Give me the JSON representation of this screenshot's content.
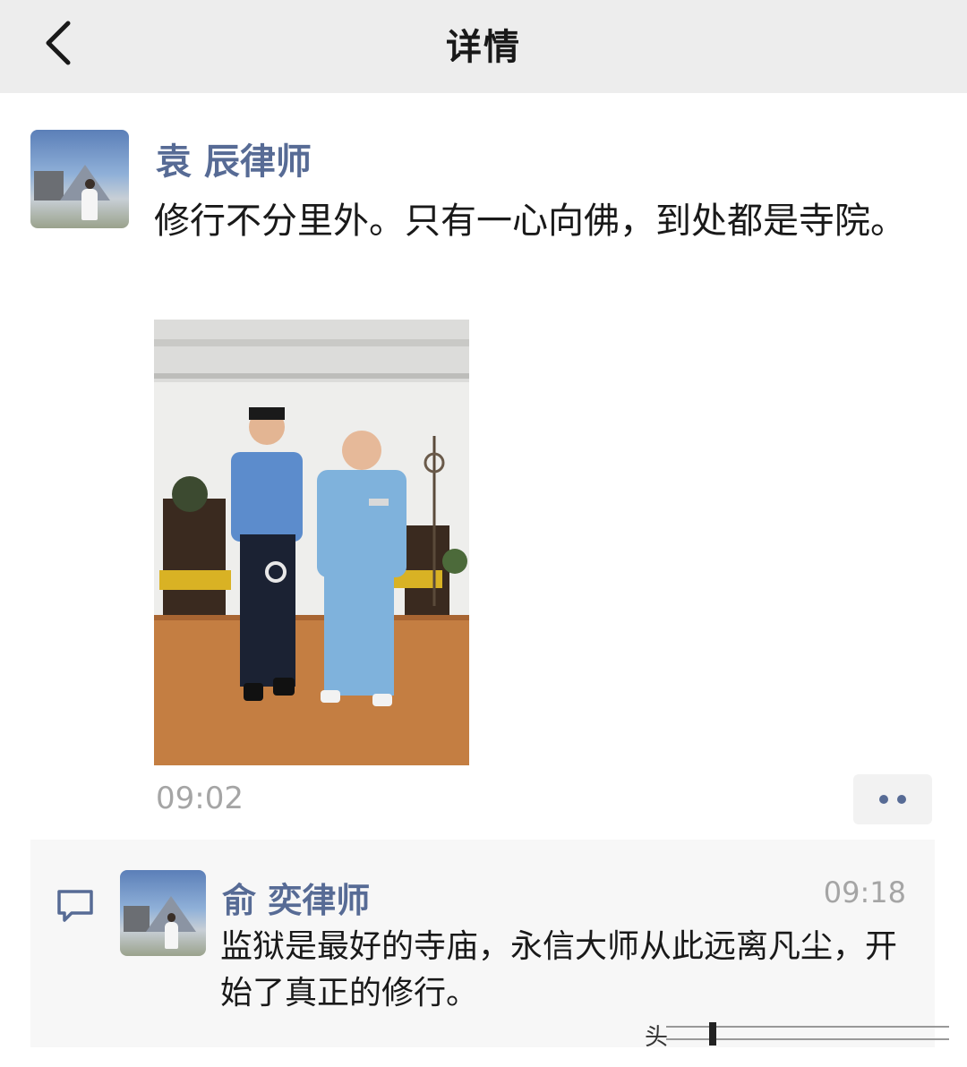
{
  "navbar": {
    "title": "详情",
    "back_icon": "chevron-left-icon"
  },
  "post": {
    "author": "袁 辰律师",
    "text": "修行不分里外。只有一心向佛，到处都是寺院。",
    "time": "09:02",
    "more_icon": "more-dots-icon"
  },
  "comment": {
    "author": "俞 奕律师",
    "time": "09:18",
    "text": "监狱是最好的寺庙，永信大师从此远离凡尘，开始了真正的修行。",
    "icon": "comment-icon"
  },
  "watermark": {
    "text": "头"
  },
  "colors": {
    "navbar_bg": "#ededed",
    "name_blue": "#576b95",
    "time_gray": "#a5a5a5",
    "comment_bg": "#f7f7f7"
  }
}
